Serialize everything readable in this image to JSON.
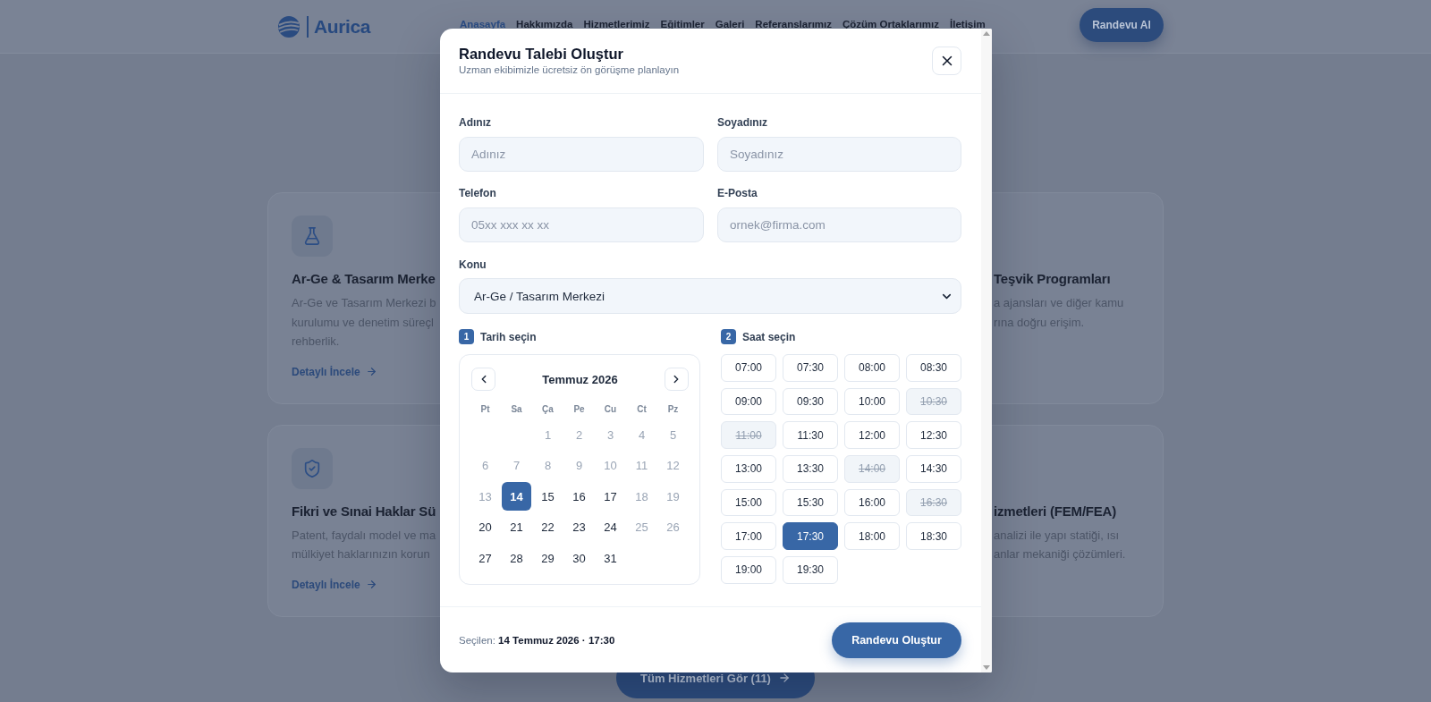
{
  "nav": {
    "logo": "Aurica",
    "links": [
      {
        "label": "Anasayfa",
        "selected": true
      },
      {
        "label": "Hakkımızda",
        "selected": false
      },
      {
        "label": "Hizmetlerimiz",
        "selected": false
      },
      {
        "label": "Eğitimler",
        "selected": false
      },
      {
        "label": "Galeri",
        "selected": false
      },
      {
        "label": "Referanslarımız",
        "selected": false
      },
      {
        "label": "Çözüm Ortaklarımız",
        "selected": false
      },
      {
        "label": "İletişim",
        "selected": false
      }
    ],
    "cta": "Randevu Al"
  },
  "services": {
    "left_column": [
      {
        "title": "Ar-Ge & Tasarım Merke",
        "description": [
          "Ar-Ge ve Tasarım Merkezi b",
          "kurulumu ve denetim süreçl",
          "rehberlik."
        ],
        "link": "Detaylı İncele"
      },
      {
        "title": "Fikri ve Sınai Haklar Sü",
        "description": [
          "Patent, faydalı model ve ma",
          "mülkiyet haklarınızın korun"
        ],
        "link": "Detaylı İncele"
      }
    ],
    "right_column": [
      {
        "title": "Teşvik Programları",
        "description": [
          "a ajansları ve diğer kamu",
          "rına doğru erişim."
        ]
      },
      {
        "title": "izmetleri (FEM/FEA)",
        "description": [
          "analizi ile yapı statiği, ısı",
          "anlar mekaniği çözümleri."
        ]
      }
    ],
    "all_button": "Tüm Hizmetleri Gör (11)"
  },
  "modal": {
    "title": "Randevu Talebi Oluştur",
    "subtitle": "Uzman ekibimizle ücretsiz ön görüşme planlayın",
    "fields": [
      {
        "label": "Adınız",
        "placeholder": "Adınız"
      },
      {
        "label": "Soyadınız",
        "placeholder": "Soyadınız"
      },
      {
        "label": "Telefon",
        "placeholder": "05xx xxx xx xx"
      },
      {
        "label": "E-Posta",
        "placeholder": "ornek@firma.com"
      }
    ],
    "topic": {
      "label": "Konu",
      "value": "Ar-Ge / Tasarım Merkezi"
    },
    "date_step": {
      "number": "1",
      "label": "Tarih seçin"
    },
    "time_step": {
      "number": "2",
      "label": "Saat seçin"
    },
    "calendar": {
      "month": "Temmuz 2026",
      "weekdays": [
        "Pt",
        "Sa",
        "Ça",
        "Pe",
        "Cu",
        "Ct",
        "Pz"
      ],
      "days": [
        {
          "kind": "empty"
        },
        {
          "kind": "empty"
        },
        {
          "kind": "day",
          "label": "1",
          "disabled": true,
          "selected": false
        },
        {
          "kind": "day",
          "label": "2",
          "disabled": true,
          "selected": false
        },
        {
          "kind": "day",
          "label": "3",
          "disabled": true,
          "selected": false
        },
        {
          "kind": "day",
          "label": "4",
          "disabled": true,
          "selected": false
        },
        {
          "kind": "day",
          "label": "5",
          "disabled": true,
          "selected": false
        },
        {
          "kind": "day",
          "label": "6",
          "disabled": true,
          "selected": false
        },
        {
          "kind": "day",
          "label": "7",
          "disabled": true,
          "selected": false
        },
        {
          "kind": "day",
          "label": "8",
          "disabled": true,
          "selected": false
        },
        {
          "kind": "day",
          "label": "9",
          "disabled": true,
          "selected": false
        },
        {
          "kind": "day",
          "label": "10",
          "disabled": true,
          "selected": false
        },
        {
          "kind": "day",
          "label": "11",
          "disabled": true,
          "selected": false
        },
        {
          "kind": "day",
          "label": "12",
          "disabled": true,
          "selected": false
        },
        {
          "kind": "day",
          "label": "13",
          "disabled": true,
          "selected": false
        },
        {
          "kind": "day",
          "label": "14",
          "disabled": false,
          "selected": true
        },
        {
          "kind": "day",
          "label": "15",
          "disabled": false,
          "selected": false
        },
        {
          "kind": "day",
          "label": "16",
          "disabled": false,
          "selected": false
        },
        {
          "kind": "day",
          "label": "17",
          "disabled": false,
          "selected": false
        },
        {
          "kind": "day",
          "label": "18",
          "disabled": true,
          "selected": false
        },
        {
          "kind": "day",
          "label": "19",
          "disabled": true,
          "selected": false
        },
        {
          "kind": "day",
          "label": "20",
          "disabled": false,
          "selected": false
        },
        {
          "kind": "day",
          "label": "21",
          "disabled": false,
          "selected": false
        },
        {
          "kind": "day",
          "label": "22",
          "disabled": false,
          "selected": false
        },
        {
          "kind": "day",
          "label": "23",
          "disabled": false,
          "selected": false
        },
        {
          "kind": "day",
          "label": "24",
          "disabled": false,
          "selected": false
        },
        {
          "kind": "day",
          "label": "25",
          "disabled": true,
          "selected": false
        },
        {
          "kind": "day",
          "label": "26",
          "disabled": true,
          "selected": false
        },
        {
          "kind": "day",
          "label": "27",
          "disabled": false,
          "selected": false
        },
        {
          "kind": "day",
          "label": "28",
          "disabled": false,
          "selected": false
        },
        {
          "kind": "day",
          "label": "29",
          "disabled": false,
          "selected": false
        },
        {
          "kind": "day",
          "label": "30",
          "disabled": false,
          "selected": false
        },
        {
          "kind": "day",
          "label": "31",
          "disabled": false,
          "selected": false
        }
      ]
    },
    "time_slots": [
      {
        "label": "07:00",
        "disabled": false,
        "selected": false
      },
      {
        "label": "07:30",
        "disabled": false,
        "selected": false
      },
      {
        "label": "08:00",
        "disabled": false,
        "selected": false
      },
      {
        "label": "08:30",
        "disabled": false,
        "selected": false
      },
      {
        "label": "09:00",
        "disabled": false,
        "selected": false
      },
      {
        "label": "09:30",
        "disabled": false,
        "selected": false
      },
      {
        "label": "10:00",
        "disabled": false,
        "selected": false
      },
      {
        "label": "10:30",
        "disabled": true,
        "selected": false
      },
      {
        "label": "11:00",
        "disabled": true,
        "selected": false
      },
      {
        "label": "11:30",
        "disabled": false,
        "selected": false
      },
      {
        "label": "12:00",
        "disabled": false,
        "selected": false
      },
      {
        "label": "12:30",
        "disabled": false,
        "selected": false
      },
      {
        "label": "13:00",
        "disabled": false,
        "selected": false
      },
      {
        "label": "13:30",
        "disabled": false,
        "selected": false
      },
      {
        "label": "14:00",
        "disabled": true,
        "selected": false
      },
      {
        "label": "14:30",
        "disabled": false,
        "selected": false
      },
      {
        "label": "15:00",
        "disabled": false,
        "selected": false
      },
      {
        "label": "15:30",
        "disabled": false,
        "selected": false
      },
      {
        "label": "16:00",
        "disabled": false,
        "selected": false
      },
      {
        "label": "16:30",
        "disabled": true,
        "selected": false
      },
      {
        "label": "17:00",
        "disabled": false,
        "selected": false
      },
      {
        "label": "17:30",
        "disabled": false,
        "selected": true
      },
      {
        "label": "18:00",
        "disabled": false,
        "selected": false
      },
      {
        "label": "18:30",
        "disabled": false,
        "selected": false
      },
      {
        "label": "19:00",
        "disabled": false,
        "selected": false
      },
      {
        "label": "19:30",
        "disabled": false,
        "selected": false
      }
    ],
    "summary": "Seçilen: **14 Temmuz 2026 · 17:30**",
    "submit": "Randevu Oluştur"
  }
}
